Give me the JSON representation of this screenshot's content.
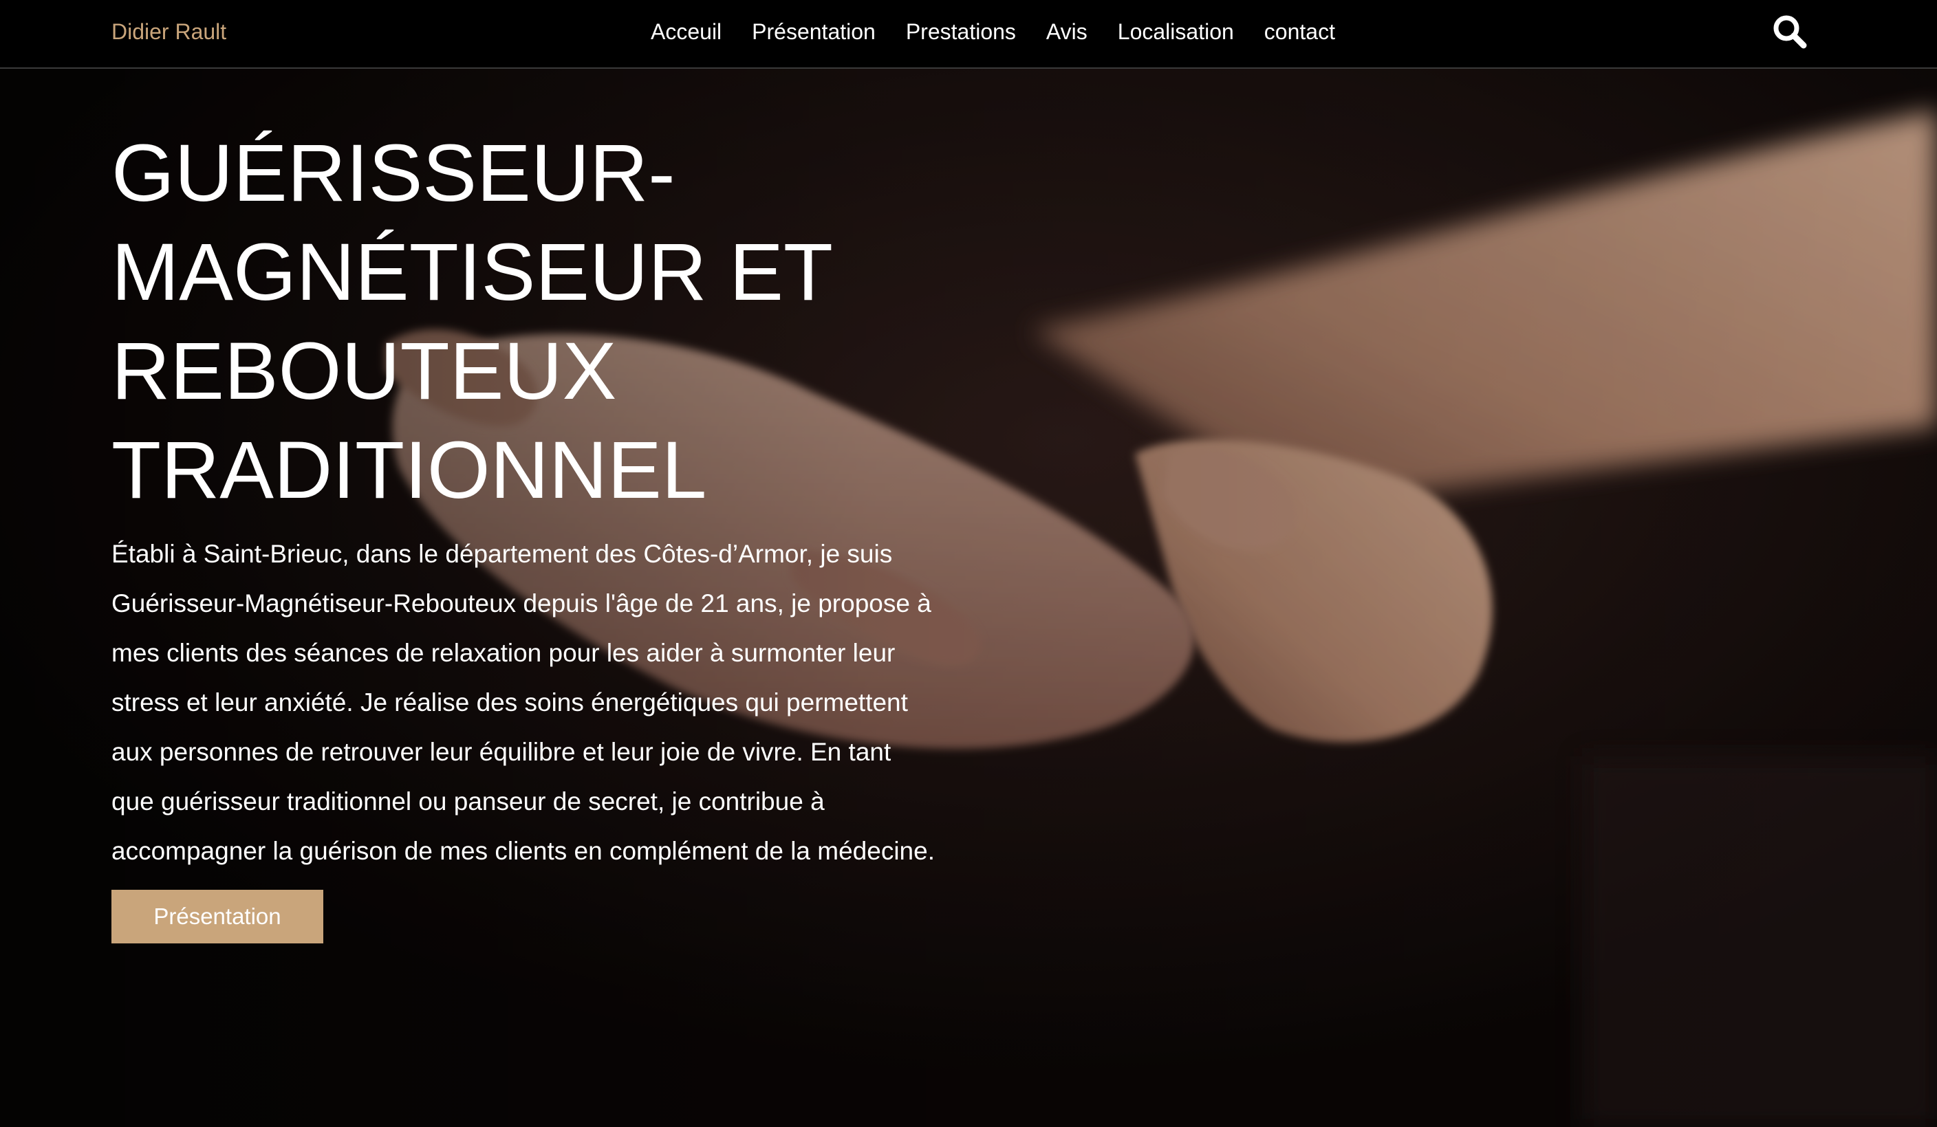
{
  "header": {
    "brand": "Didier Rault",
    "nav": [
      {
        "label": "Acceuil"
      },
      {
        "label": "Présentation"
      },
      {
        "label": "Prestations"
      },
      {
        "label": "Avis"
      },
      {
        "label": "Localisation"
      },
      {
        "label": "contact"
      }
    ],
    "search_icon": "search-icon"
  },
  "hero": {
    "title": "GUÉRISSEUR-MAGNÉTISEUR ET REBOUTEUX TRADITIONNEL",
    "text": "Établi à Saint-Brieuc, dans le département des Côtes-d’Armor, je suis Guérisseur-Magnétiseur-Rebouteux depuis l'âge de 21 ans, je propose à mes clients des séances de relaxation pour les aider à surmonter leur stress et leur anxiété. Je réalise des soins énergétiques qui permettent aux personnes de retrouver leur équilibre et leur joie de vivre. En tant que guérisseur traditionnel ou panseur de secret, je contribue à accompagner la guérison de mes clients en complément de la médecine.",
    "button_label": "Présentation",
    "background_image": "hands"
  },
  "colors": {
    "accent": "#c9a57b",
    "topbar": "#000000",
    "text": "#ffffff"
  }
}
